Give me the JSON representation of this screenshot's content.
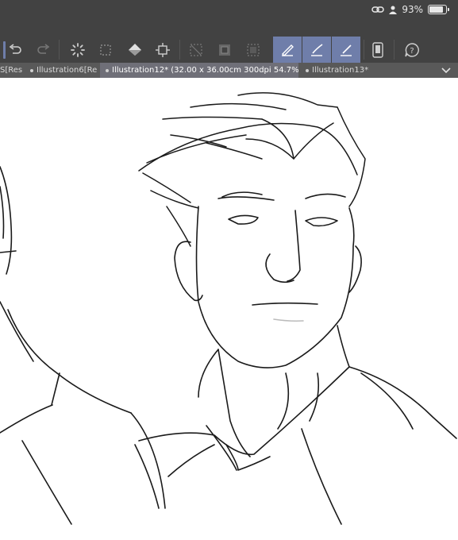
{
  "status_bar": {
    "battery_percent_label": "93%",
    "battery_level": 0.93,
    "icons": [
      "link-icon",
      "person-icon",
      "battery-icon"
    ]
  },
  "toolbar": {
    "buttons": [
      {
        "name": "undo",
        "icon": "undo-icon"
      },
      {
        "name": "redo",
        "icon": "redo-icon"
      },
      {
        "name": "loading",
        "icon": "spinner-icon"
      },
      {
        "name": "selection",
        "icon": "marquee-icon"
      },
      {
        "name": "fill",
        "icon": "fill-bucket-icon"
      },
      {
        "name": "transform",
        "icon": "transform-icon"
      },
      {
        "name": "clear",
        "icon": "clear-icon"
      },
      {
        "name": "clear-outside",
        "icon": "clear-outside-icon"
      },
      {
        "name": "deselect",
        "icon": "deselect-icon"
      },
      {
        "name": "pen-1",
        "icon": "pen-icon"
      },
      {
        "name": "pen-2",
        "icon": "brush-icon"
      },
      {
        "name": "pen-3",
        "icon": "eraser-icon"
      },
      {
        "name": "device",
        "icon": "tablet-icon"
      },
      {
        "name": "help",
        "icon": "help-icon"
      }
    ],
    "active_color": "#6f7eaa"
  },
  "tabs": [
    {
      "label": "S[Res",
      "active": false
    },
    {
      "label": "Illustration6[Re",
      "active": false
    },
    {
      "label": "Illustration12* (32.00 x 36.00cm 300dpi 54.7%)",
      "active": true
    },
    {
      "label": "Illustration13*",
      "active": false
    }
  ],
  "colors": {
    "chrome": "#424242",
    "tab_bar": "#595959",
    "active_tab": "#6f6f78",
    "canvas": "#ffffff",
    "ink": "#1a1a1a"
  }
}
